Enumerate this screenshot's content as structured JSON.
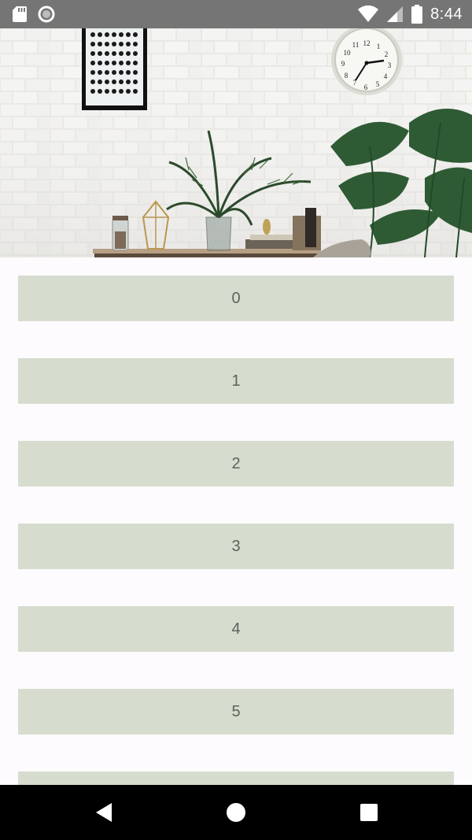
{
  "status_bar": {
    "time": "8:44",
    "icons": [
      "sd-card-icon",
      "sync-circle-icon",
      "wifi-icon",
      "cell-signal-icon",
      "battery-icon"
    ]
  },
  "header_image": {
    "description_icon": "room-interior-image",
    "clock_numbers": [
      "12",
      "1",
      "2",
      "3",
      "4",
      "5",
      "6",
      "7",
      "8",
      "9",
      "10",
      "11"
    ]
  },
  "list": {
    "items": [
      {
        "label": "0"
      },
      {
        "label": "1"
      },
      {
        "label": "2"
      },
      {
        "label": "3"
      },
      {
        "label": "4"
      },
      {
        "label": "5"
      },
      {
        "label": ""
      }
    ],
    "item_color": "#d6ddce",
    "text_color": "#5d625c"
  },
  "nav_bar": {
    "buttons": [
      "back-icon",
      "home-icon",
      "recents-icon"
    ]
  },
  "colors": {
    "status_bar": "#757575",
    "nav_bar": "#000000",
    "background": "#fdfbfd"
  }
}
